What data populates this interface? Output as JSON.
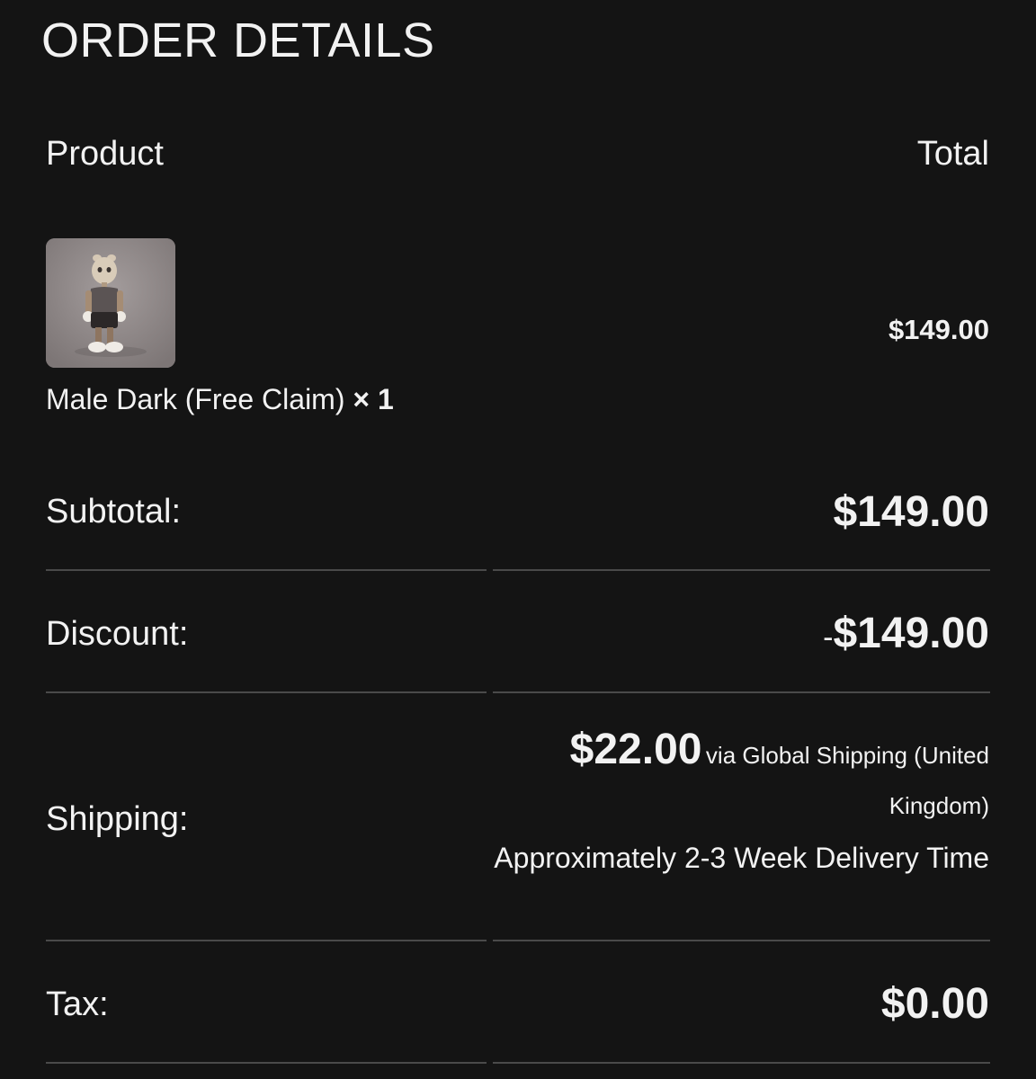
{
  "page": {
    "title": "ORDER DETAILS"
  },
  "table": {
    "product_header": "Product",
    "total_header": "Total"
  },
  "items": [
    {
      "name": "Male Dark (Free Claim)",
      "quantity": "× 1",
      "total": "$149.00",
      "image": "figure-toy-image"
    }
  ],
  "summary": {
    "subtotal_label": "Subtotal:",
    "subtotal_value": "$149.00",
    "discount_label": "Discount:",
    "discount_sign": "-",
    "discount_value": "$149.00",
    "shipping_label": "Shipping:",
    "shipping_amount": "$22.00",
    "shipping_method": "via Global Shipping (United Kingdom)",
    "shipping_time": "Approximately 2-3 Week Delivery Time",
    "tax_label": "Tax:",
    "tax_value": "$0.00"
  },
  "colors": {
    "background": "#141414",
    "text": "#f2f2f2",
    "divider": "#4a4a4a"
  }
}
